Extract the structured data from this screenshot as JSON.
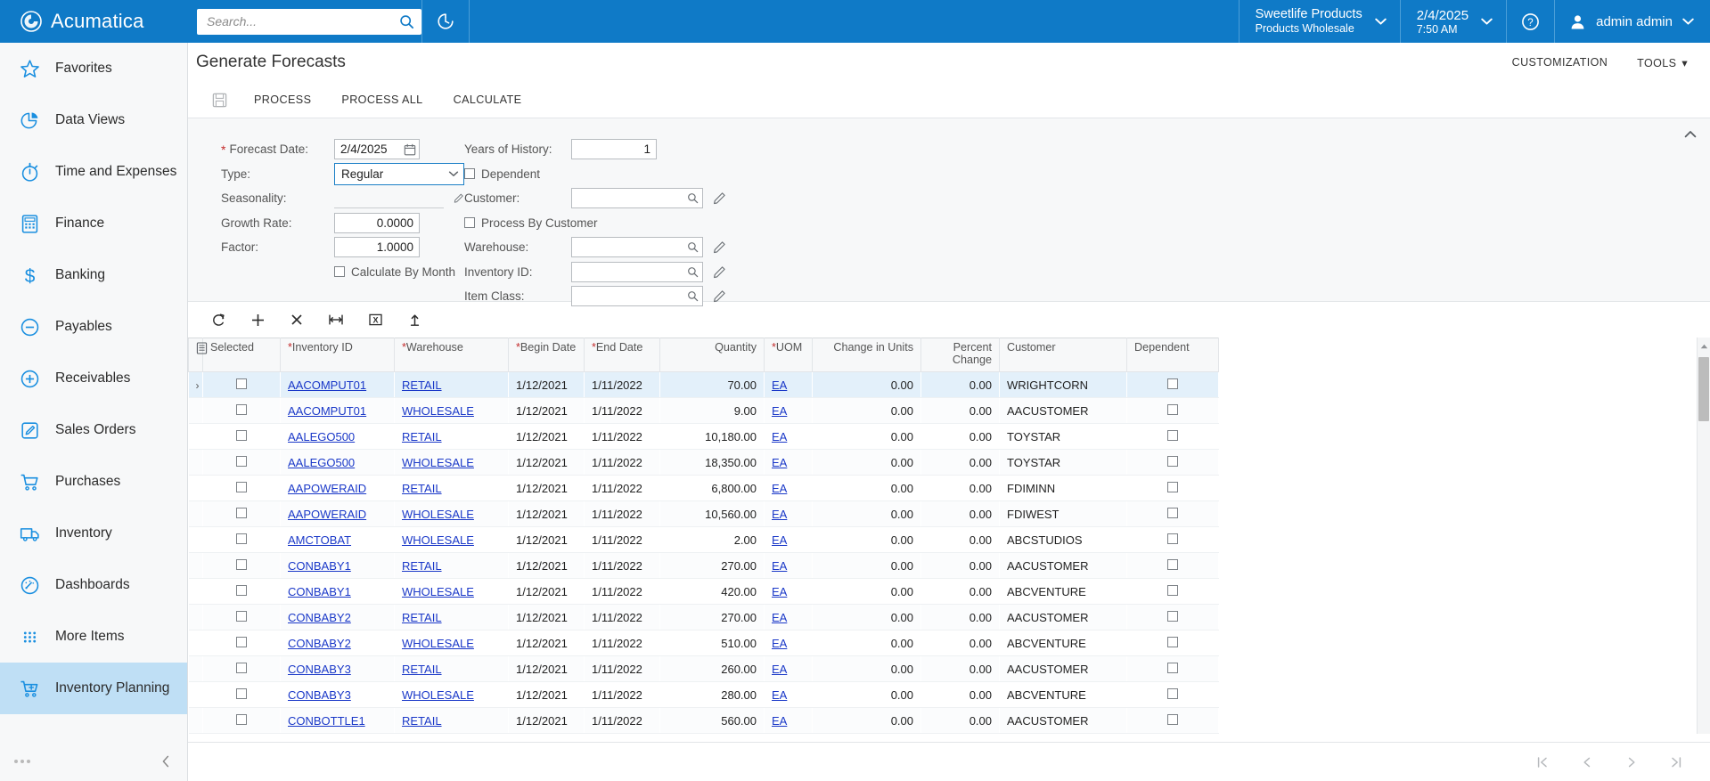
{
  "header": {
    "brand": "Acumatica",
    "brand_icon": "acumatica-logo-icon",
    "search_placeholder": "Search...",
    "search_value": "",
    "search_icon": "search-icon",
    "recent_icon": "recent-history-icon",
    "company_name": "Sweetlife Products",
    "company_branch": "Products Wholesale",
    "date": "2/4/2025",
    "time": "7:50 AM",
    "help_icon": "help-circle-icon",
    "user_icon": "user-avatar-icon",
    "user_name": "admin admin",
    "accent_color": "#0f7ac7"
  },
  "sidebar": {
    "items": [
      {
        "label": "Favorites",
        "icon": "star-icon",
        "active": false
      },
      {
        "label": "Data Views",
        "icon": "pie-chart-icon",
        "active": false
      },
      {
        "label": "Time and Expenses",
        "icon": "stopwatch-icon",
        "active": false
      },
      {
        "label": "Finance",
        "icon": "calculator-icon",
        "active": false
      },
      {
        "label": "Banking",
        "icon": "dollar-sign-icon",
        "active": false
      },
      {
        "label": "Payables",
        "icon": "minus-circle-icon",
        "active": false
      },
      {
        "label": "Receivables",
        "icon": "plus-circle-icon",
        "active": false
      },
      {
        "label": "Sales Orders",
        "icon": "pencil-square-icon",
        "active": false
      },
      {
        "label": "Purchases",
        "icon": "shopping-cart-icon",
        "active": false
      },
      {
        "label": "Inventory",
        "icon": "truck-icon",
        "active": false
      },
      {
        "label": "Dashboards",
        "icon": "gauge-icon",
        "active": false
      },
      {
        "label": "More Items",
        "icon": "grid-dots-icon",
        "active": false
      },
      {
        "label": "Inventory Planning",
        "icon": "cart-plus-icon",
        "active": true
      }
    ],
    "more_icon": "ellipsis-icon",
    "collapse_icon": "chevron-left-icon",
    "active_bg": "#bfdff5"
  },
  "page": {
    "title": "Generate Forecasts",
    "customization_label": "CUSTOMIZATION",
    "tools_label": "TOOLS"
  },
  "toolbar": {
    "save_icon": "save-disk-icon",
    "buttons": [
      {
        "label": "PROCESS"
      },
      {
        "label": "PROCESS ALL"
      },
      {
        "label": "CALCULATE"
      }
    ]
  },
  "form": {
    "collapse_icon": "chevron-up-icon",
    "forecast_date_label": "Forecast Date:",
    "forecast_date_value": "2/4/2025",
    "forecast_date_icon": "calendar-icon",
    "type_label": "Type:",
    "type_value": "Regular",
    "type_caret_icon": "chevron-down-icon",
    "seasonality_label": "Seasonality:",
    "seasonality_value": "",
    "seasonality_edit_icon": "pencil-icon",
    "growth_rate_label": "Growth Rate:",
    "growth_rate_value": "0.0000",
    "factor_label": "Factor:",
    "factor_value": "1.0000",
    "calculate_by_month_label": "Calculate By Month",
    "calculate_by_month_checked": false,
    "years_of_history_label": "Years of History:",
    "years_of_history_value": "1",
    "dependent_label": "Dependent",
    "dependent_checked": false,
    "customer_label": "Customer:",
    "customer_value": "",
    "process_by_customer_label": "Process By Customer",
    "process_by_customer_checked": false,
    "warehouse_label": "Warehouse:",
    "warehouse_value": "",
    "inventory_id_label": "Inventory ID:",
    "inventory_id_value": "",
    "item_class_label": "Item Class:",
    "item_class_value": "",
    "lookup_icon": "magnifier-icon",
    "edit_icon": "pencil-icon"
  },
  "grid_toolbar": {
    "buttons": [
      {
        "icon": "refresh-icon",
        "name": "refresh-button"
      },
      {
        "icon": "plus-icon",
        "name": "add-row-button"
      },
      {
        "icon": "close-x-icon",
        "name": "delete-row-button"
      },
      {
        "icon": "fit-columns-icon",
        "name": "fit-columns-button"
      },
      {
        "icon": "export-excel-icon",
        "name": "export-excel-button"
      },
      {
        "icon": "upload-icon",
        "name": "upload-file-button"
      }
    ]
  },
  "grid": {
    "config_icon": "column-config-icon",
    "columns": [
      {
        "label": "Selected",
        "required": false,
        "align": "left"
      },
      {
        "label": "Inventory ID",
        "required": true,
        "align": "left"
      },
      {
        "label": "Warehouse",
        "required": true,
        "align": "left"
      },
      {
        "label": "Begin Date",
        "required": true,
        "align": "left"
      },
      {
        "label": "End Date",
        "required": true,
        "align": "left"
      },
      {
        "label": "Quantity",
        "required": false,
        "align": "right"
      },
      {
        "label": "UOM",
        "required": true,
        "align": "left"
      },
      {
        "label": "Change in Units",
        "required": false,
        "align": "right"
      },
      {
        "label": "Percent Change",
        "required": false,
        "align": "right"
      },
      {
        "label": "Customer",
        "required": false,
        "align": "left"
      },
      {
        "label": "Dependent",
        "required": false,
        "align": "left"
      }
    ],
    "rows": [
      {
        "selected": false,
        "inventory_id": "AACOMPUT01",
        "warehouse": "RETAIL",
        "begin_date": "1/12/2021",
        "end_date": "1/11/2022",
        "quantity": "70.00",
        "uom": "EA",
        "change_in_units": "0.00",
        "percent_change": "0.00",
        "customer": "WRIGHTCORN",
        "dependent": false,
        "active": true
      },
      {
        "selected": false,
        "inventory_id": "AACOMPUT01",
        "warehouse": "WHOLESALE",
        "begin_date": "1/12/2021",
        "end_date": "1/11/2022",
        "quantity": "9.00",
        "uom": "EA",
        "change_in_units": "0.00",
        "percent_change": "0.00",
        "customer": "AACUSTOMER",
        "dependent": false,
        "active": false
      },
      {
        "selected": false,
        "inventory_id": "AALEGO500",
        "warehouse": "RETAIL",
        "begin_date": "1/12/2021",
        "end_date": "1/11/2022",
        "quantity": "10,180.00",
        "uom": "EA",
        "change_in_units": "0.00",
        "percent_change": "0.00",
        "customer": "TOYSTAR",
        "dependent": false,
        "active": false
      },
      {
        "selected": false,
        "inventory_id": "AALEGO500",
        "warehouse": "WHOLESALE",
        "begin_date": "1/12/2021",
        "end_date": "1/11/2022",
        "quantity": "18,350.00",
        "uom": "EA",
        "change_in_units": "0.00",
        "percent_change": "0.00",
        "customer": "TOYSTAR",
        "dependent": false,
        "active": false
      },
      {
        "selected": false,
        "inventory_id": "AAPOWERAID",
        "warehouse": "RETAIL",
        "begin_date": "1/12/2021",
        "end_date": "1/11/2022",
        "quantity": "6,800.00",
        "uom": "EA",
        "change_in_units": "0.00",
        "percent_change": "0.00",
        "customer": "FDIMINN",
        "dependent": false,
        "active": false
      },
      {
        "selected": false,
        "inventory_id": "AAPOWERAID",
        "warehouse": "WHOLESALE",
        "begin_date": "1/12/2021",
        "end_date": "1/11/2022",
        "quantity": "10,560.00",
        "uom": "EA",
        "change_in_units": "0.00",
        "percent_change": "0.00",
        "customer": "FDIWEST",
        "dependent": false,
        "active": false
      },
      {
        "selected": false,
        "inventory_id": "AMCTOBAT",
        "warehouse": "WHOLESALE",
        "begin_date": "1/12/2021",
        "end_date": "1/11/2022",
        "quantity": "2.00",
        "uom": "EA",
        "change_in_units": "0.00",
        "percent_change": "0.00",
        "customer": "ABCSTUDIOS",
        "dependent": false,
        "active": false
      },
      {
        "selected": false,
        "inventory_id": "CONBABY1",
        "warehouse": "RETAIL",
        "begin_date": "1/12/2021",
        "end_date": "1/11/2022",
        "quantity": "270.00",
        "uom": "EA",
        "change_in_units": "0.00",
        "percent_change": "0.00",
        "customer": "AACUSTOMER",
        "dependent": false,
        "active": false
      },
      {
        "selected": false,
        "inventory_id": "CONBABY1",
        "warehouse": "WHOLESALE",
        "begin_date": "1/12/2021",
        "end_date": "1/11/2022",
        "quantity": "420.00",
        "uom": "EA",
        "change_in_units": "0.00",
        "percent_change": "0.00",
        "customer": "ABCVENTURE",
        "dependent": false,
        "active": false
      },
      {
        "selected": false,
        "inventory_id": "CONBABY2",
        "warehouse": "RETAIL",
        "begin_date": "1/12/2021",
        "end_date": "1/11/2022",
        "quantity": "270.00",
        "uom": "EA",
        "change_in_units": "0.00",
        "percent_change": "0.00",
        "customer": "AACUSTOMER",
        "dependent": false,
        "active": false
      },
      {
        "selected": false,
        "inventory_id": "CONBABY2",
        "warehouse": "WHOLESALE",
        "begin_date": "1/12/2021",
        "end_date": "1/11/2022",
        "quantity": "510.00",
        "uom": "EA",
        "change_in_units": "0.00",
        "percent_change": "0.00",
        "customer": "ABCVENTURE",
        "dependent": false,
        "active": false
      },
      {
        "selected": false,
        "inventory_id": "CONBABY3",
        "warehouse": "RETAIL",
        "begin_date": "1/12/2021",
        "end_date": "1/11/2022",
        "quantity": "260.00",
        "uom": "EA",
        "change_in_units": "0.00",
        "percent_change": "0.00",
        "customer": "AACUSTOMER",
        "dependent": false,
        "active": false
      },
      {
        "selected": false,
        "inventory_id": "CONBABY3",
        "warehouse": "WHOLESALE",
        "begin_date": "1/12/2021",
        "end_date": "1/11/2022",
        "quantity": "280.00",
        "uom": "EA",
        "change_in_units": "0.00",
        "percent_change": "0.00",
        "customer": "ABCVENTURE",
        "dependent": false,
        "active": false
      },
      {
        "selected": false,
        "inventory_id": "CONBOTTLE1",
        "warehouse": "RETAIL",
        "begin_date": "1/12/2021",
        "end_date": "1/11/2022",
        "quantity": "560.00",
        "uom": "EA",
        "change_in_units": "0.00",
        "percent_change": "0.00",
        "customer": "AACUSTOMER",
        "dependent": false,
        "active": false
      }
    ]
  },
  "pager": {
    "first_icon": "page-first-icon",
    "prev_icon": "page-prev-icon",
    "next_icon": "page-next-icon",
    "last_icon": "page-last-icon"
  }
}
